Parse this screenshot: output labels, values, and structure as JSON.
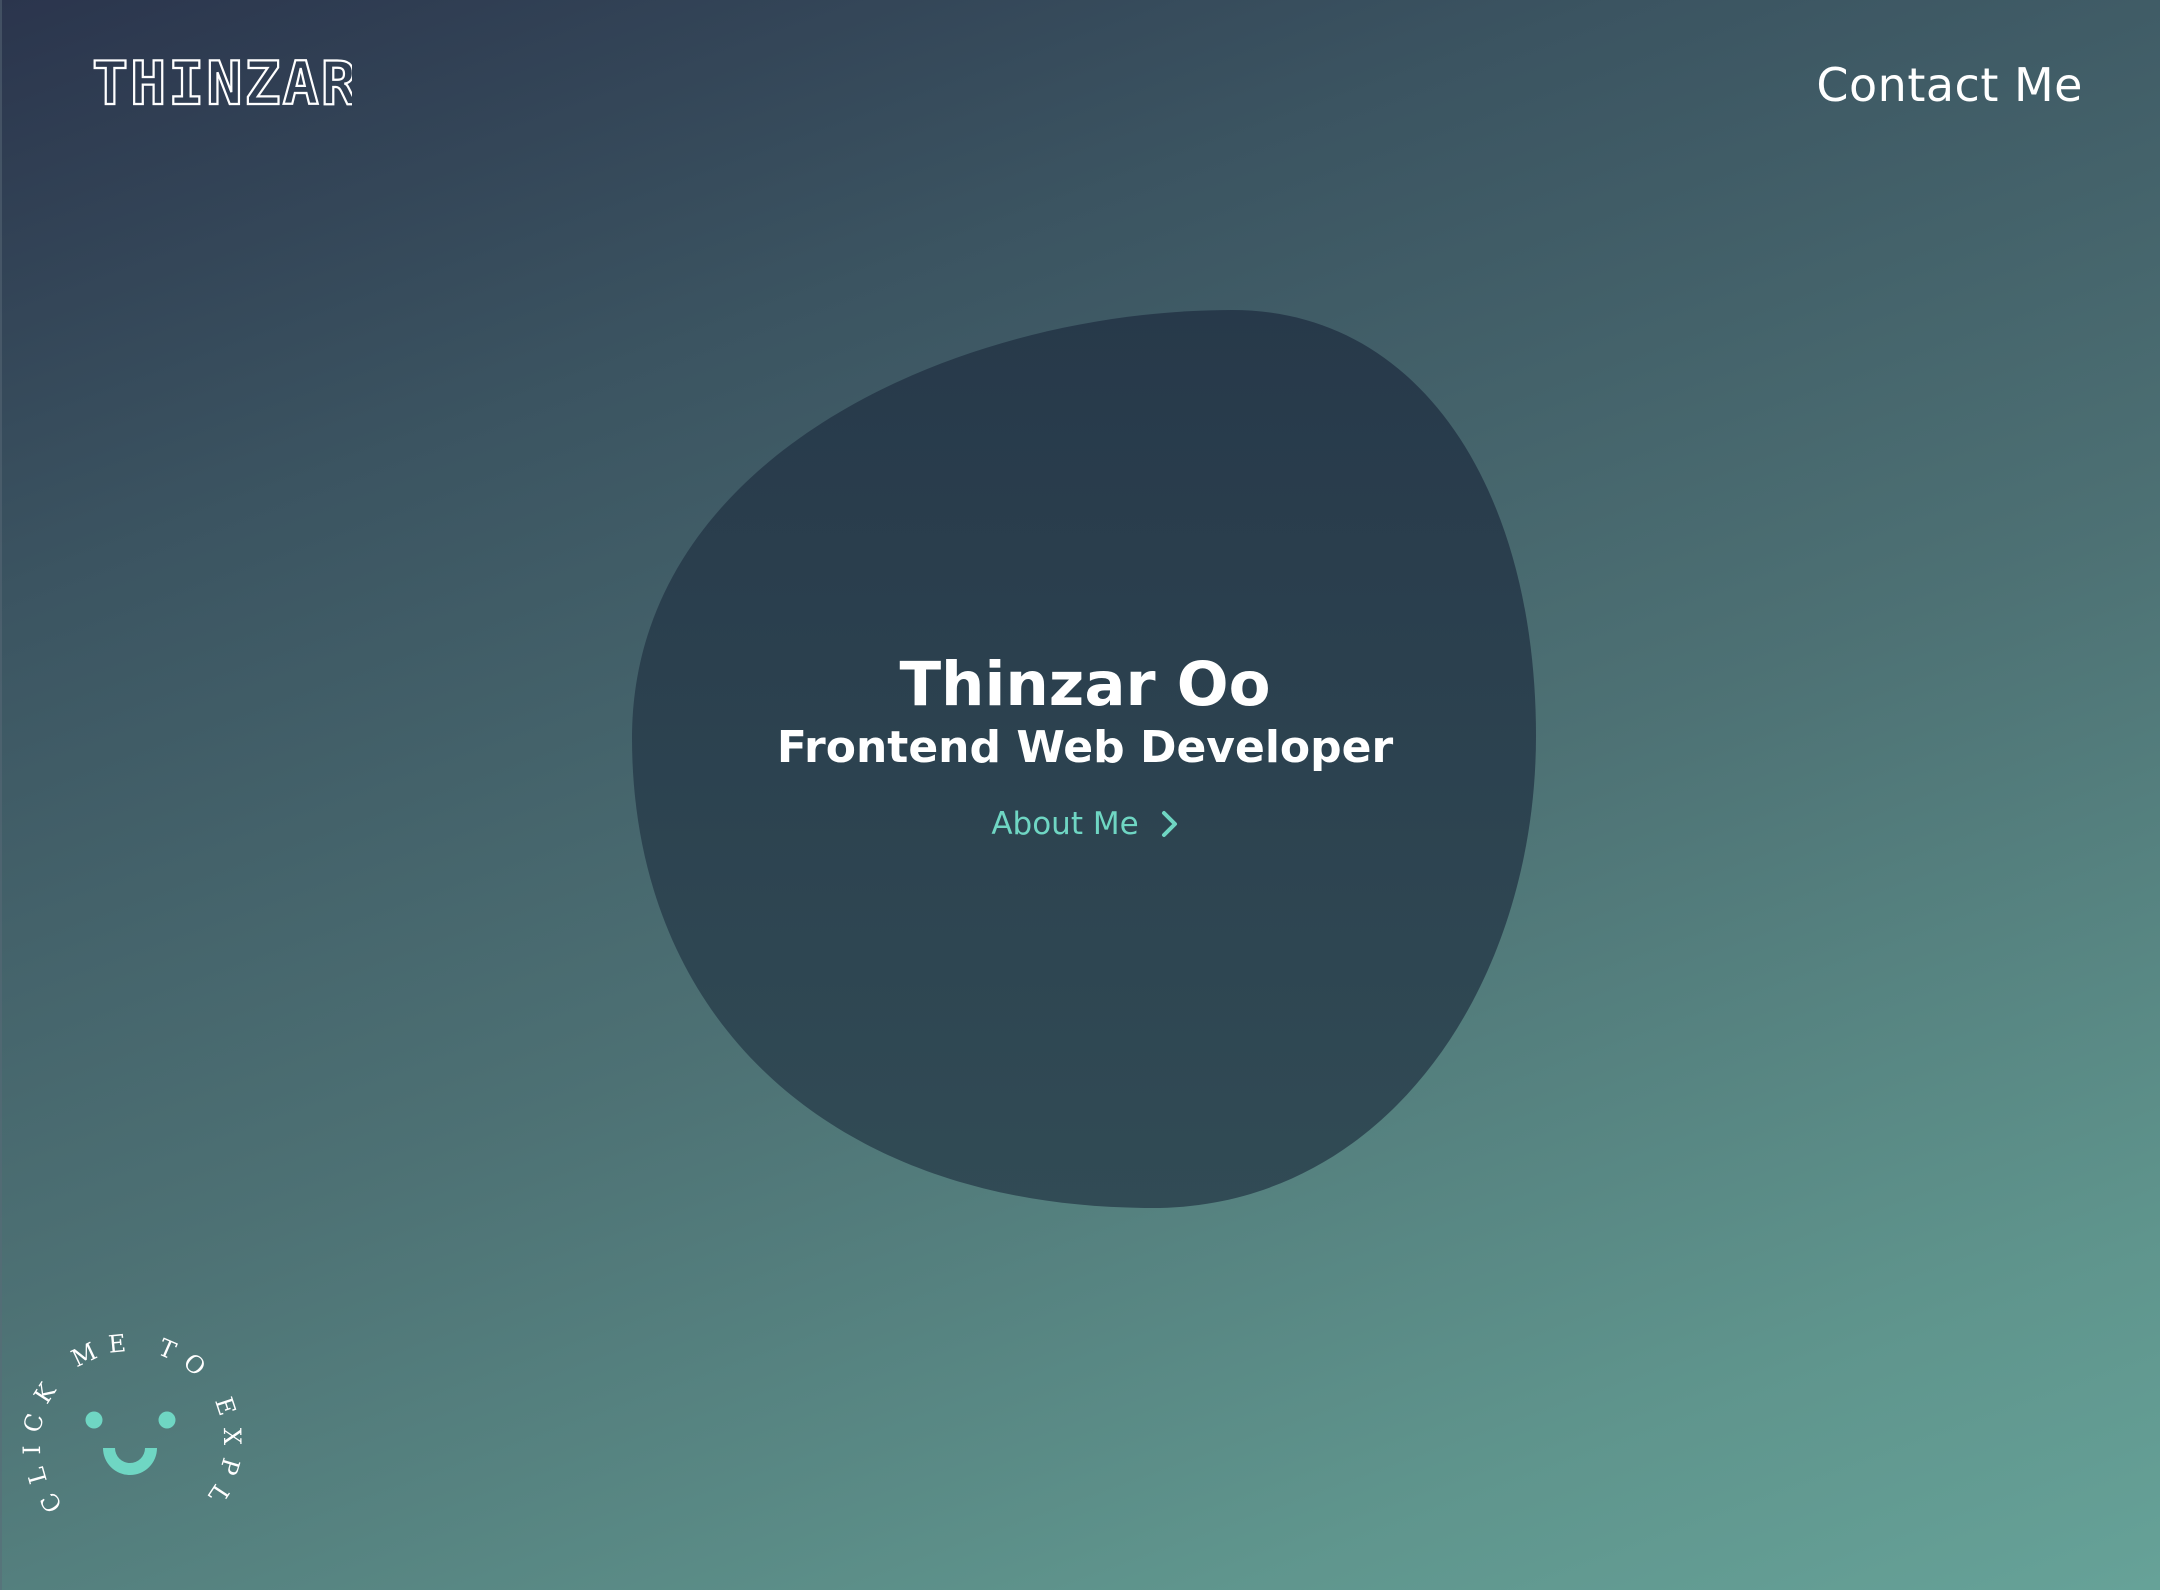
{
  "header": {
    "logo_text": "THINZAR",
    "contact_label": "Contact Me"
  },
  "hero": {
    "name": "Thinzar Oo",
    "role": "Frontend Web Developer",
    "about_label": "About Me",
    "about_icon": "chevron-right-icon"
  },
  "badge": {
    "circular_text": "CLICK ME TO EXPLORE!",
    "icon": "smiley-icon"
  },
  "colors": {
    "accent": "#6fd6c3",
    "blob": "#2b3c4b",
    "gradient_start": "#2b354d",
    "gradient_end": "#66a298",
    "text": "#ffffff"
  }
}
